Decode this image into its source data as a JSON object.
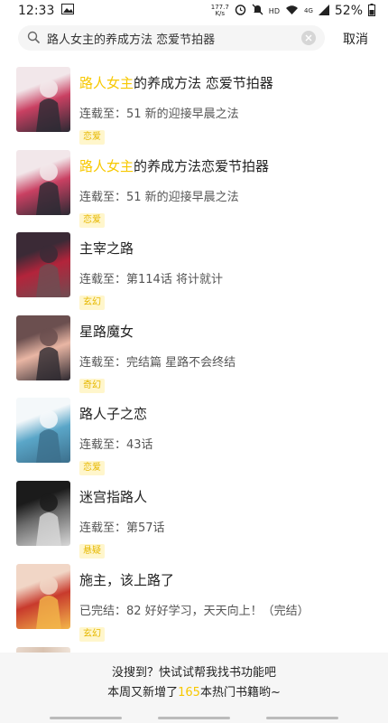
{
  "status_bar": {
    "time": "12:33",
    "net_speed_value": "177.7",
    "net_speed_unit": "K/s",
    "network_type": "4G",
    "battery": "52%"
  },
  "search": {
    "query": "路人女主的养成方法 恋爱节拍器",
    "cancel_label": "取消"
  },
  "results": [
    {
      "title_highlight": "路人女主",
      "title_rest": "的养成方法 恋爱节拍器",
      "latest": "连载至：51 新的迎接早晨之法",
      "tag": "恋爱",
      "cover_colors": [
        "#f2e7ea",
        "#c94062",
        "#2a2a33"
      ]
    },
    {
      "title_highlight": "路人女主",
      "title_rest": "的养成方法恋爱节拍器",
      "latest": "连载至：51 新的迎接早晨之法",
      "tag": "恋爱",
      "cover_colors": [
        "#f2e7ea",
        "#c94062",
        "#2a2a33"
      ]
    },
    {
      "title_highlight": "",
      "title_rest": "主宰之路",
      "latest": "连载至：第114话 将计就计",
      "tag": "玄幻",
      "cover_colors": [
        "#3b2a36",
        "#b3243b",
        "#6e4d52"
      ]
    },
    {
      "title_highlight": "",
      "title_rest": "星路魔女",
      "latest": "连载至：完结篇 星路不会终结",
      "tag": "奇幻",
      "cover_colors": [
        "#6b4f4f",
        "#e9b6a4",
        "#2d2930"
      ]
    },
    {
      "title_highlight": "",
      "title_rest": "路人子之恋",
      "latest": "连载至：43话",
      "tag": "恋爱",
      "cover_colors": [
        "#f4f8fa",
        "#5aa6c8",
        "#3c6f8c"
      ]
    },
    {
      "title_highlight": "",
      "title_rest": "迷宫指路人",
      "latest": "连载至：第57话",
      "tag": "悬疑",
      "cover_colors": [
        "#1b1b1b",
        "#6d6d6d",
        "#d9d9d9"
      ]
    },
    {
      "title_highlight": "",
      "title_rest": "施主，该上路了",
      "latest": "已完结：82 好好学习，天天向上！（完结）",
      "tag": "玄幻",
      "cover_colors": [
        "#f1d6c6",
        "#c83a2c",
        "#f3b64a"
      ]
    }
  ],
  "footer": {
    "line1": "没搜到？快试试帮我找书功能吧",
    "line2_prefix": "本周又新增了",
    "line2_count": "165",
    "line2_suffix": "本热门书籍哟~"
  }
}
